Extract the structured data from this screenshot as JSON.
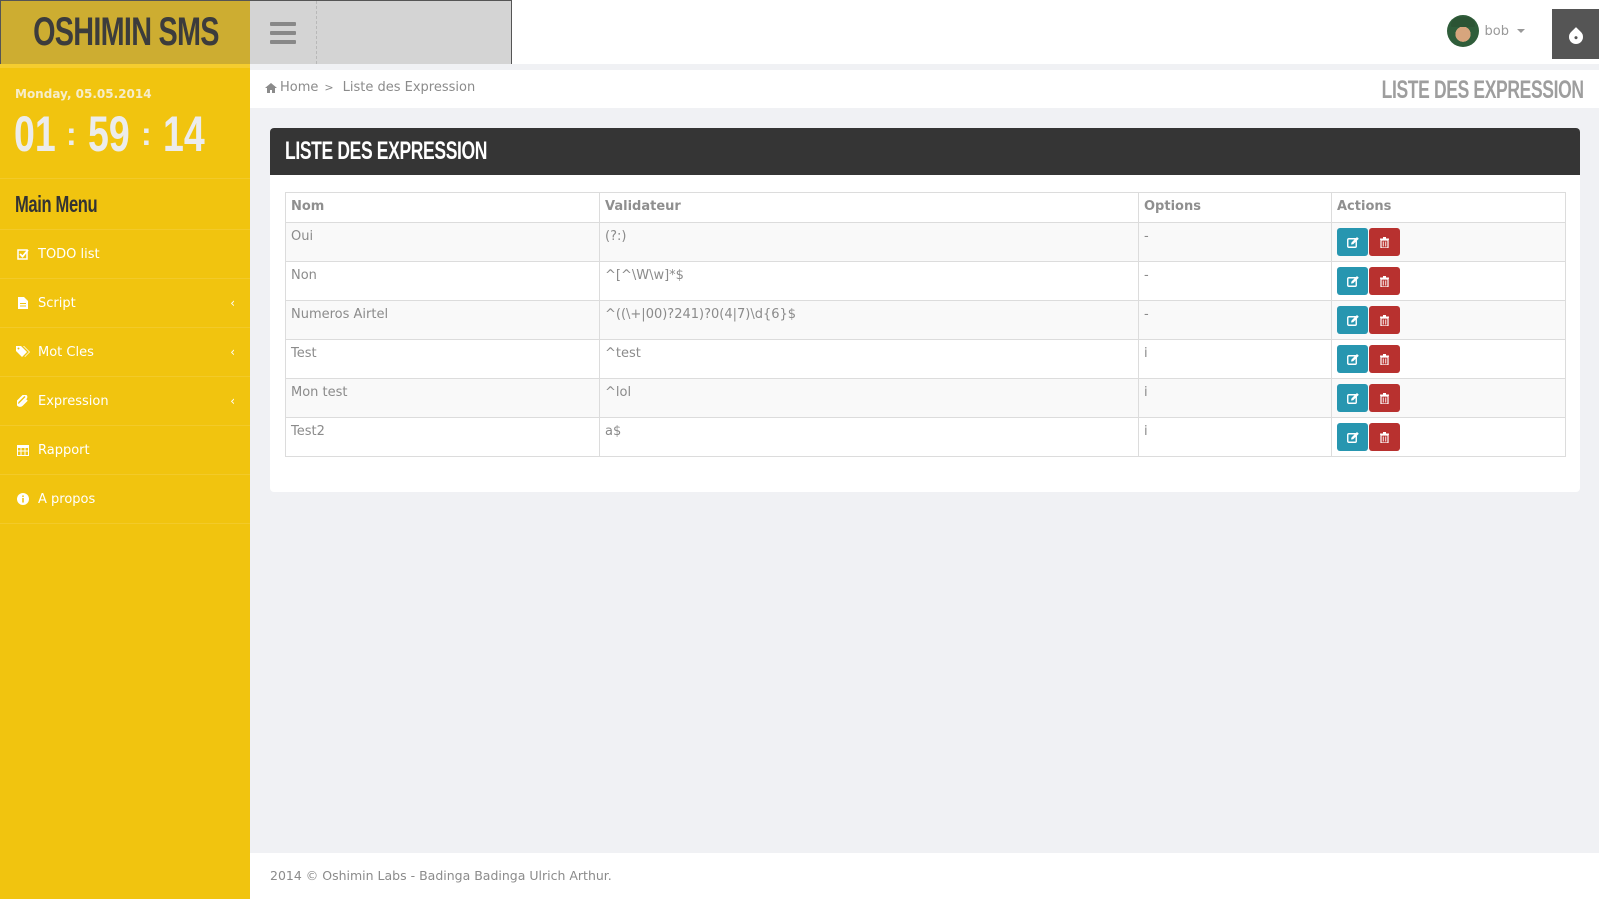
{
  "header": {
    "brand": "OSHIMIN SMS",
    "user": {
      "name": "bob"
    },
    "icons": {
      "menu_toggle": "hamburger-icon",
      "theme": "water-drop-icon"
    }
  },
  "sidebar": {
    "date": "Monday, 05.05.2014",
    "clock": {
      "hours": "01",
      "minutes": "59",
      "seconds": "14",
      "separator": ":"
    },
    "menu_title": "Main Menu",
    "items": [
      {
        "label": "TODO list",
        "icon": "check-square-icon",
        "has_submenu": false
      },
      {
        "label": "Script",
        "icon": "file-text-icon",
        "has_submenu": true
      },
      {
        "label": "Mot Cles",
        "icon": "tags-icon",
        "has_submenu": true
      },
      {
        "label": "Expression",
        "icon": "paperclip-icon",
        "has_submenu": true
      },
      {
        "label": "Rapport",
        "icon": "table-icon",
        "has_submenu": false
      },
      {
        "label": "A propos",
        "icon": "info-circle-icon",
        "has_submenu": false
      }
    ]
  },
  "breadcrumb": {
    "home": "Home",
    "separator": ">",
    "current": "Liste des Expression"
  },
  "page_title": "LISTE DES EXPRESSION",
  "panel": {
    "title": "LISTE DES EXPRESSION",
    "table": {
      "columns": [
        "Nom",
        "Validateur",
        "Options",
        "Actions"
      ],
      "rows": [
        {
          "nom": "Oui",
          "validateur": "(?:)",
          "options": "-"
        },
        {
          "nom": "Non",
          "validateur": "^[^\\W\\w]*$",
          "options": "-"
        },
        {
          "nom": "Numeros Airtel",
          "validateur": "^((\\+|00)?241)?0(4|7)\\d{6}$",
          "options": "-"
        },
        {
          "nom": "Test",
          "validateur": "^test",
          "options": "i"
        },
        {
          "nom": "Mon test",
          "validateur": "^lol",
          "options": "i"
        },
        {
          "nom": "Test2",
          "validateur": "a$",
          "options": "i"
        }
      ],
      "row_actions": {
        "edit": "edit-icon",
        "delete": "trash-icon"
      }
    }
  },
  "colors": {
    "sidebar": "#f1c40f",
    "brand_bg": "#cdad31",
    "edit_button": "#2796b0",
    "delete_button": "#b8312f",
    "panel_header": "#353535"
  },
  "footer": {
    "text": "2014 © Oshimin Labs - Badinga Badinga Ulrich Arthur."
  }
}
